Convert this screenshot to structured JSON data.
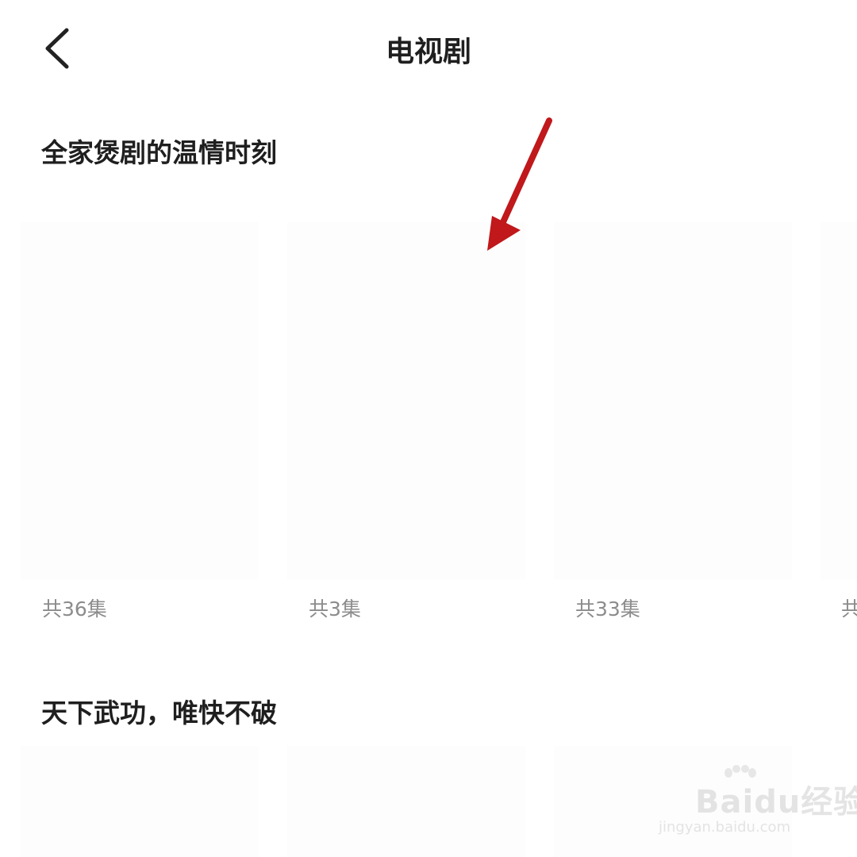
{
  "header": {
    "title": "电视剧",
    "back_icon": "chevron-left-icon"
  },
  "sections": [
    {
      "title": "全家煲剧的温情时刻",
      "items": [
        {
          "episodes": "共36集"
        },
        {
          "episodes": "共3集"
        },
        {
          "episodes": "共33集"
        },
        {
          "episodes": "共"
        }
      ]
    },
    {
      "title": "天下武功，唯快不破"
    }
  ],
  "annotation": {
    "arrow_color": "#c0181b"
  },
  "watermark": {
    "brand": "Baidu经验",
    "url": "jingyan.baidu.com"
  }
}
